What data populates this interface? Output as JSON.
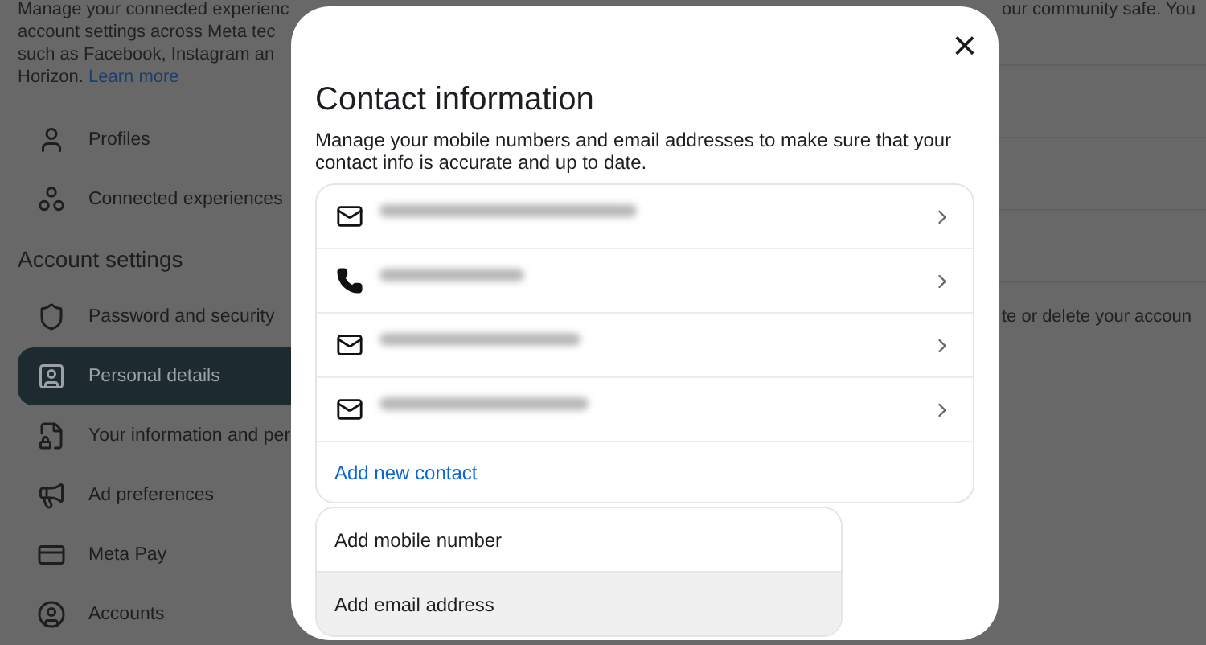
{
  "sidebar": {
    "intro_lines": [
      "Manage your connected experienc",
      "account settings across Meta tec",
      "such as Facebook, Instagram an"
    ],
    "intro_last": "Horizon.",
    "learn_more": "Learn more",
    "items": [
      {
        "kind": "profile",
        "label": "Profiles",
        "selected": false
      },
      {
        "kind": "connected",
        "label": "Connected experiences",
        "selected": false
      },
      {
        "kind": "heading",
        "label": "Account settings"
      },
      {
        "kind": "security",
        "label": "Password and security",
        "selected": false
      },
      {
        "kind": "personal",
        "label": "Personal details",
        "selected": true
      },
      {
        "kind": "info",
        "label": "Your information and per",
        "selected": false
      },
      {
        "kind": "ads",
        "label": "Ad preferences",
        "selected": false
      },
      {
        "kind": "pay",
        "label": "Meta Pay",
        "selected": false
      },
      {
        "kind": "accounts",
        "label": "Accounts",
        "selected": false
      }
    ]
  },
  "background_text": [
    "our community safe. You",
    "te or delete your accoun"
  ],
  "dialog": {
    "close": "×",
    "title": "Contact information",
    "description": "Manage your mobile numbers and email addresses to make sure that your contact info is accurate and up to date.",
    "contacts": [
      {
        "kind": "email",
        "redacted": true
      },
      {
        "kind": "phone",
        "redacted": true
      },
      {
        "kind": "email",
        "redacted": true
      },
      {
        "kind": "email",
        "redacted": true
      }
    ],
    "add_contact": "Add new contact",
    "menu": [
      {
        "label": "Add mobile number",
        "highlighted": false
      },
      {
        "label": "Add email address",
        "highlighted": true
      }
    ]
  }
}
